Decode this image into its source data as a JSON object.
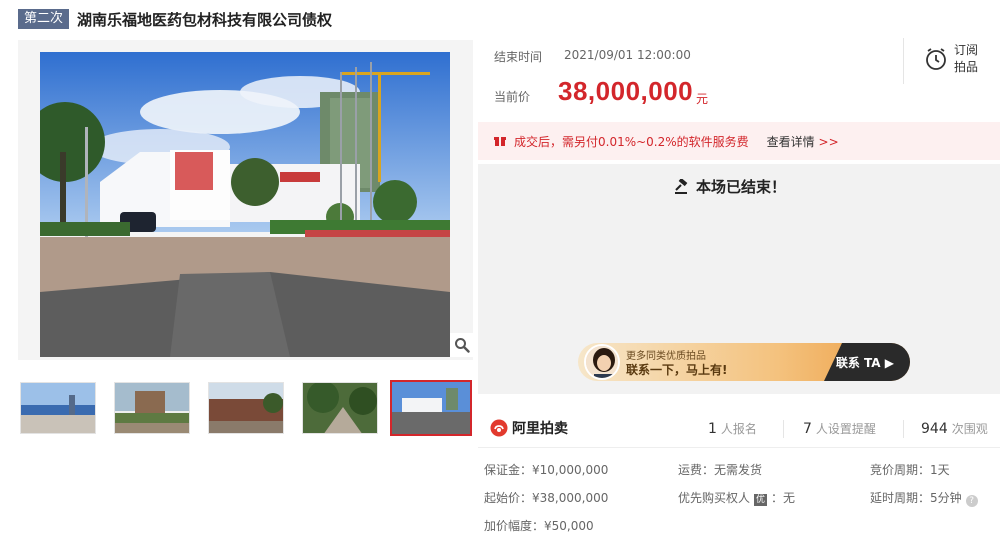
{
  "header": {
    "round_badge": "第二次",
    "title": "湖南乐福地医药包材科技有限公司债权"
  },
  "gallery": {
    "main_photo": "factory-photo",
    "thumbnails": [
      "thumb-1",
      "thumb-2",
      "thumb-3",
      "thumb-4",
      "thumb-5"
    ],
    "active_index": 4
  },
  "auction": {
    "end_time_label": "结束时间",
    "end_time_value": "2021/09/01 12:00:00",
    "price_label": "当前价",
    "price_value": "38,000,000",
    "price_unit": "元",
    "subscribe_label": "订阅拍品"
  },
  "fee_notice": {
    "text": "成交后，需另付0.01%~0.2%的软件服务费",
    "link_text": "查看详情",
    "link_arrow": ">>"
  },
  "status": {
    "ended_text": "本场已结束！"
  },
  "banner": {
    "line1": "更多同类优质拍品",
    "line2": "联系一下，马上有!",
    "cta": "联系 TA"
  },
  "stats": {
    "brand": "阿里拍卖",
    "signup_count": "1",
    "signup_label": "人报名",
    "reminder_count": "7",
    "reminder_label": "人设置提醒",
    "views_count": "944",
    "views_label": "次围观"
  },
  "details": {
    "deposit": "保证金：¥10,000,000",
    "shipping": "运费：无需发货",
    "cycle": "竞价周期：1天",
    "start_price": "起始价：¥38,000,000",
    "priority_label": "优先购买权人",
    "priority_tag": "优",
    "priority_value": "：无",
    "delay": "延时周期：5分钟",
    "increment": "加价幅度：¥50,000"
  },
  "colors": {
    "accent_red": "#d3262b",
    "badge_blue": "#5a6b8c",
    "fee_bg": "#fdf0f0",
    "panel_bg": "#f2f2f2"
  }
}
